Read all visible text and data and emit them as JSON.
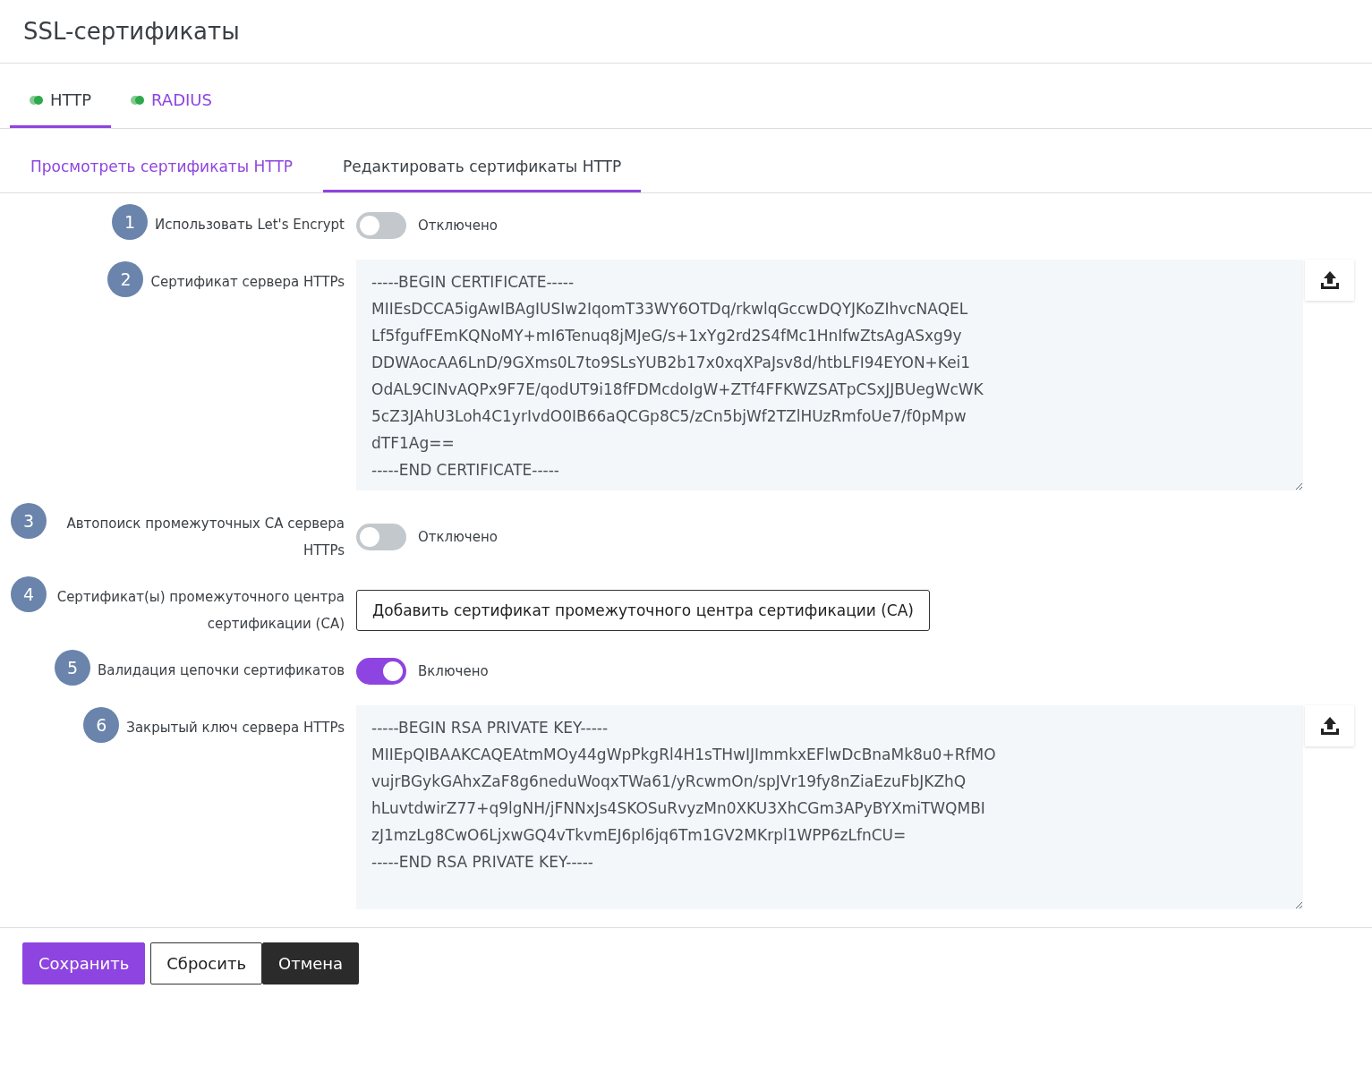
{
  "title": "SSL-сертификаты",
  "tabs": [
    {
      "label": "HTTP",
      "selected": true,
      "color": "#2ea84a"
    },
    {
      "label": "RADIUS",
      "selected": false,
      "color": "#2ea84a"
    }
  ],
  "subtabs": [
    {
      "label": "Просмотреть сертификаты HTTP",
      "selected": false
    },
    {
      "label": "Редактировать сертификаты HTTP",
      "selected": true
    }
  ],
  "fields": [
    {
      "kind": "toggle",
      "number": "1",
      "label": "Использовать Let's Encrypt",
      "on": false,
      "status": "Отключено"
    },
    {
      "kind": "textarea",
      "number": "2",
      "label": "Сертификат сервера HTTPs",
      "lines": [
        "-----BEGIN CERTIFICATE-----",
        "MIIEsDCCA5igAwIBAgIUSIw2IqomT33WY6OTDq/rkwlqGccwDQYJKoZIhvcNAQEL",
        "Lf5fgufFEmKQNoMY+mI6Tenuq8jMJeG/s+1xYg2rd2S4fMc1HnIfwZtsAgASxg9y",
        "DDWAocAA6LnD/9GXms0L7to9SLsYUB2b17x0xqXPaJsv8d/htbLFI94EYON+Kei1",
        "OdAL9CINvAQPx9F7E/qodUT9i18fFDMcdoIgW+ZTf4FFKWZSATpCSxJJBUegWcWK",
        "5cZ3JAhU3Loh4C1yrIvdO0IB66aQCGp8C5/zCn5bjWf2TZlHUzRmfoUe7/f0pMpw",
        "dTF1Ag==",
        "-----END CERTIFICATE-----"
      ]
    },
    {
      "kind": "toggle",
      "number": "3",
      "label": "Автопоиск промежуточных CA сервера HTTPs",
      "on": false,
      "status": "Отключено"
    },
    {
      "kind": "button",
      "number": "4",
      "label": "Сертификат(ы) промежуточного центра сертификации (CA)",
      "button": "Добавить сертификат промежуточного центра сертификации (CA)"
    },
    {
      "kind": "toggle",
      "number": "5",
      "label": "Валидация цепочки сертификатов",
      "on": true,
      "status": "Включено"
    },
    {
      "kind": "textarea",
      "number": "6",
      "label": "Закрытый ключ сервера HTTPs",
      "lines": [
        "-----BEGIN RSA PRIVATE KEY-----",
        "MIIEpQIBAAKCAQEAtmMOy44gWpPkgRl4H1sTHwIJImmkxEFlwDcBnaMk8u0+RfMO",
        "vujrBGykGAhxZaF8g6neduWoqxTWa61/yRcwmOn/spJVr19fy8nZiaEzuFbJKZhQ",
        "hLuvtdwirZ77+q9lgNH/jFNNxJs4SKOSuRvyzMn0XKU3XhCGm3APyBYXmiTWQMBI",
        "zJ1mzLg8CwO6LjxwGQ4vTkvmEJ6pl6jq6Tm1GV2MKrpl1WPP6zLfnCU=",
        "-----END RSA PRIVATE KEY-----"
      ]
    }
  ],
  "buttons": [
    {
      "kind": "primary",
      "label": "Сохранить"
    },
    {
      "kind": "outline",
      "label": "Сбросить"
    },
    {
      "kind": "dark",
      "label": "Отмена"
    }
  ]
}
